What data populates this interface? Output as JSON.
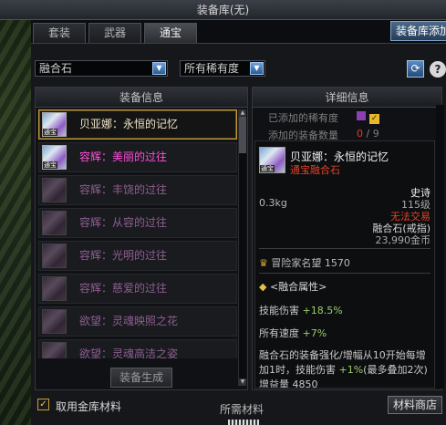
{
  "window": {
    "title": "装备库(无)",
    "top_button": "装备库添加"
  },
  "tabs": [
    {
      "label": "套装",
      "active": false
    },
    {
      "label": "武器",
      "active": false
    },
    {
      "label": "通宝",
      "active": true
    }
  ],
  "filters": {
    "category": "融合石",
    "rarity": "所有稀有度"
  },
  "icons": {
    "refresh": "refresh-icon",
    "help": "help-icon"
  },
  "left": {
    "header": "装备信息",
    "icon_tag": "通宝",
    "items": [
      {
        "label": "贝亚娜：永恒的记忆",
        "style": "gold",
        "selected": true
      },
      {
        "label": "容辉：美丽的过往",
        "style": "pink",
        "selected": false
      },
      {
        "label": "容辉：丰饶的过往",
        "style": "purple",
        "selected": false
      },
      {
        "label": "容辉：从容的过往",
        "style": "purple",
        "selected": false
      },
      {
        "label": "容辉：光明的过往",
        "style": "purple",
        "selected": false
      },
      {
        "label": "容辉：慈爱的过往",
        "style": "purple",
        "selected": false
      },
      {
        "label": "欲望：灵魂映照之花",
        "style": "purple",
        "selected": false
      },
      {
        "label": "欲望：灵魂高洁之姿",
        "style": "purple",
        "selected": false
      }
    ],
    "generate_button": "装备生成"
  },
  "right": {
    "header": "详细信息",
    "added_rarity_label": "已添加的稀有度",
    "added_count_label": "添加的装备数量",
    "added_count": "0",
    "count_sep": "/",
    "count_total": "9",
    "detail": {
      "name": "贝亚娜：永恒的记忆",
      "subtitle": "通宝融合石",
      "rarity": "史诗",
      "weight": "0.3kg",
      "level": "115级",
      "trade": "无法交易",
      "type": "融合石(戒指)",
      "price": "23,990金币",
      "fame_label": "冒险家名望",
      "fame_value": "1570",
      "attr_title": "<融合属性>",
      "skill_damage_label": "技能伤害",
      "skill_damage_value": "+18.5%",
      "all_speed_label": "所有速度",
      "all_speed_value": "+7%",
      "desc_1": "融合石的装备强化/增幅从10开始每增",
      "desc_2a": "加1时，技能伤害",
      "desc_2b": "+1%",
      "desc_2c": "(最多叠加2次)",
      "desc_3": "增益量 4850"
    }
  },
  "bottom": {
    "use_gold_label": "取用金库材料",
    "required_title": "所需材料",
    "material_shop_button": "材料商店"
  },
  "colors": {
    "epic": "#ff4fd9",
    "rare": "#9b4ea6",
    "selected_border": "#c59b3c",
    "warning_red": "#e34325",
    "accent_blue": "#4c6a8a"
  }
}
